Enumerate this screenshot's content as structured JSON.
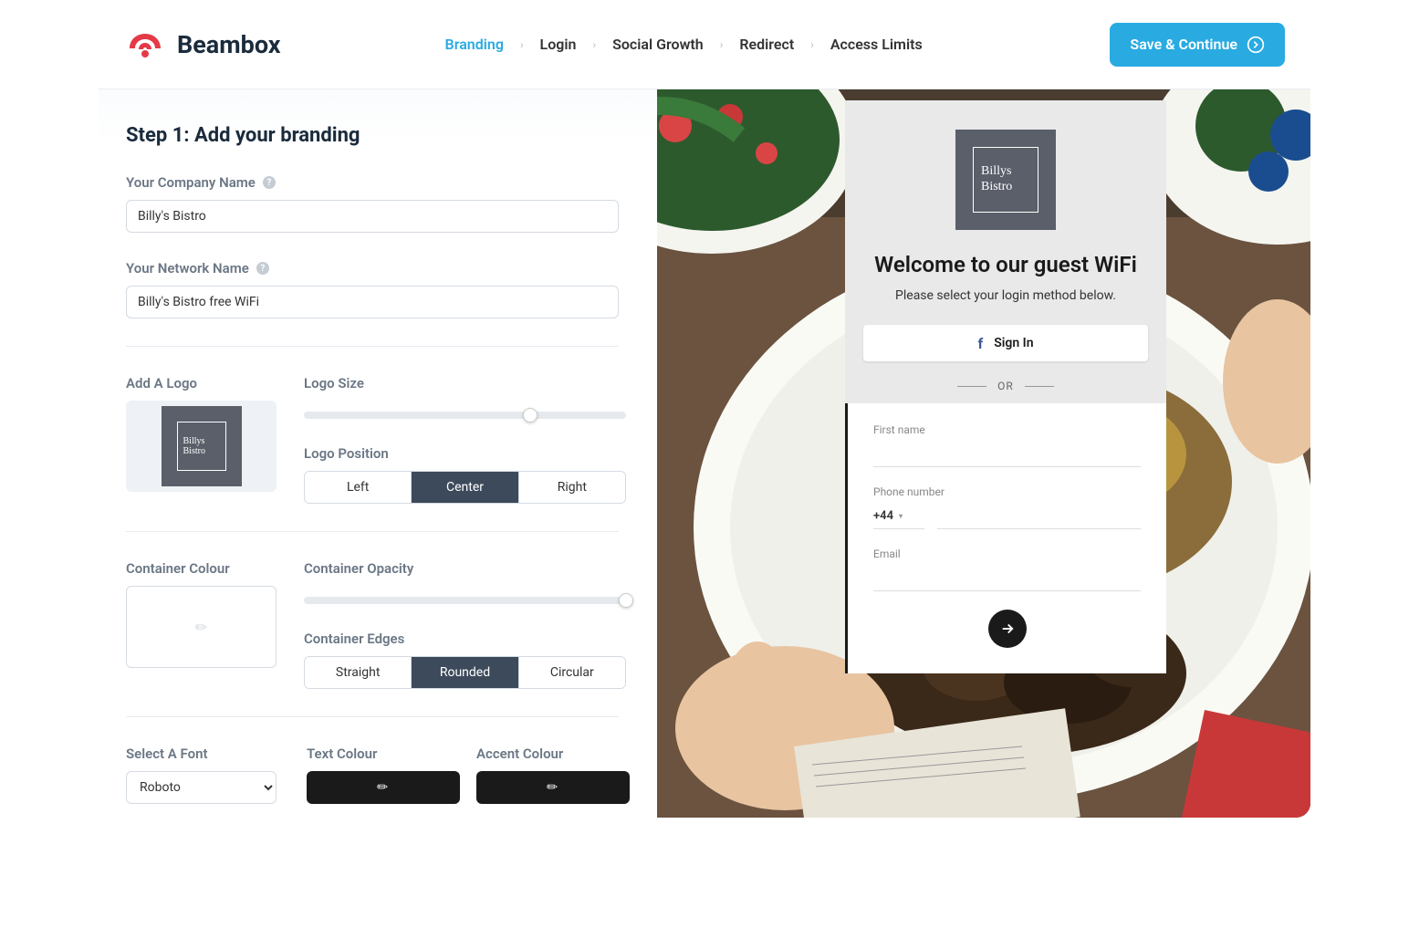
{
  "brand": {
    "name": "Beambox"
  },
  "nav": {
    "items": [
      "Branding",
      "Login",
      "Social Growth",
      "Redirect",
      "Access Limits"
    ],
    "active_index": 0
  },
  "save_button": "Save & Continue",
  "step": {
    "title": "Step 1: Add your branding"
  },
  "fields": {
    "company_label": "Your Company Name",
    "company_value": "Billy's Bistro",
    "network_label": "Your Network Name",
    "network_value": "Billy's Bistro free WiFi",
    "add_logo_label": "Add A Logo",
    "logo_size_label": "Logo Size",
    "logo_size_percent": 68,
    "logo_position_label": "Logo Position",
    "logo_position_options": [
      "Left",
      "Center",
      "Right"
    ],
    "logo_position_selected": 1,
    "container_colour_label": "Container Colour",
    "container_opacity_label": "Container Opacity",
    "container_opacity_percent": 100,
    "container_edges_label": "Container Edges",
    "container_edges_options": [
      "Straight",
      "Rounded",
      "Circular"
    ],
    "container_edges_selected": 1,
    "select_font_label": "Select A Font",
    "font_value": "Roboto",
    "text_colour_label": "Text Colour",
    "accent_colour_label": "Accent Colour",
    "text_colour": "#1a1a1a",
    "accent_colour": "#1a1a1a"
  },
  "logo_text": {
    "line1": "Billys",
    "line2": "Bistro"
  },
  "preview": {
    "title": "Welcome to our guest WiFi",
    "subtitle": "Please select your login method below.",
    "signin": "Sign In",
    "or": "OR",
    "first_name_label": "First name",
    "phone_label": "Phone number",
    "phone_code": "+44",
    "email_label": "Email"
  },
  "colors": {
    "primary": "#29abe2",
    "dark_slate": "#3d4a5c"
  }
}
